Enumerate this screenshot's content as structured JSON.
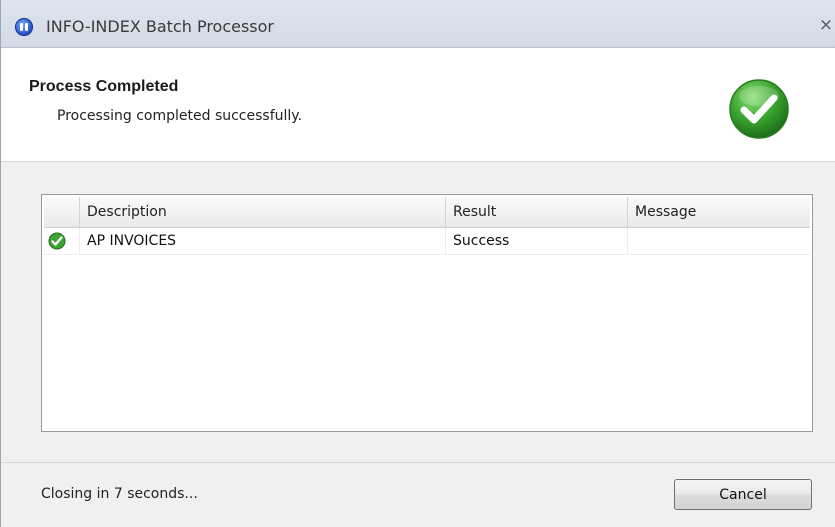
{
  "window": {
    "title": "INFO-INDEX Batch Processor",
    "close_glyph": "×",
    "app_icon": "app-icon"
  },
  "header": {
    "title": "Process Completed",
    "subtitle": "Processing completed successfully.",
    "status_icon": "success-check-icon"
  },
  "list": {
    "columns": [
      "",
      "Description",
      "Result",
      "Message"
    ],
    "rows": [
      {
        "icon": "success-check-icon",
        "description": "AP INVOICES",
        "result": "Success",
        "message": ""
      }
    ]
  },
  "footer": {
    "status": "Closing in 7 seconds...",
    "cancel_label": "Cancel"
  },
  "colors": {
    "success_green": "#3aa52f",
    "titlebar": "#d9e0ea"
  }
}
